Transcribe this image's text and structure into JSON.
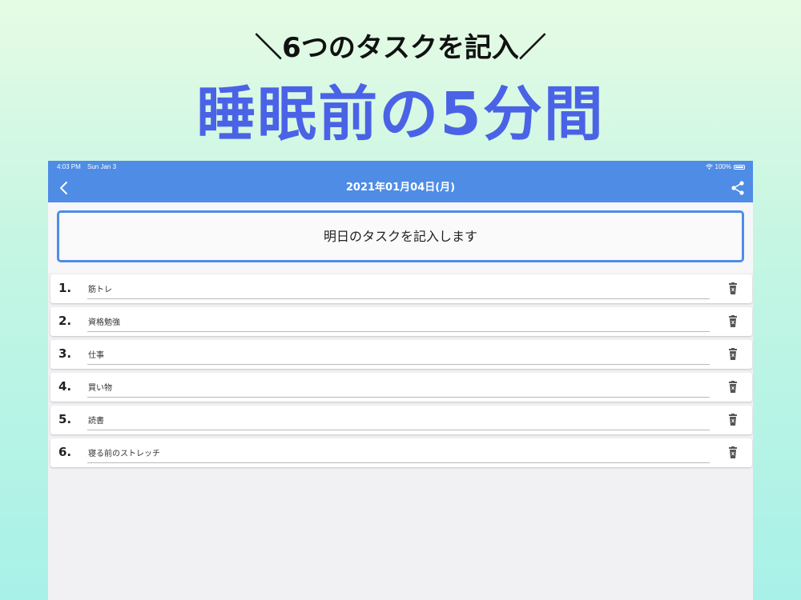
{
  "promo": {
    "subtitle": "＼6つのタスクを記入／",
    "title": "睡眠前の5分間",
    "title_color": "#4a63e6"
  },
  "statusbar": {
    "time": "4:03 PM",
    "date": "Sun Jan 3",
    "battery": "100%"
  },
  "navbar": {
    "title": "2021年01月04日(月)",
    "back_icon": "chevron-left-icon",
    "share_icon": "share-icon",
    "color": "#4e8ce6"
  },
  "header": {
    "button_label": "明日のタスクを記入します"
  },
  "tasks": [
    {
      "number": "1.",
      "text": "筋トレ"
    },
    {
      "number": "2.",
      "text": "資格勉強"
    },
    {
      "number": "3.",
      "text": "仕事"
    },
    {
      "number": "4.",
      "text": "買い物"
    },
    {
      "number": "5.",
      "text": "読書"
    },
    {
      "number": "6.",
      "text": "寝る前のストレッチ"
    }
  ]
}
